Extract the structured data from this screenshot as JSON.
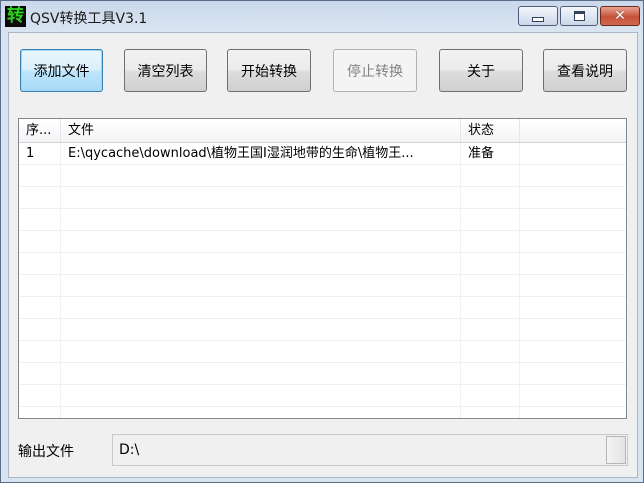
{
  "window": {
    "title": "QSV转换工具V3.1",
    "icon_char": "转"
  },
  "toolbar": {
    "add_file": "添加文件",
    "clear_list": "清空列表",
    "start_convert": "开始转换",
    "stop_convert": "停止转换",
    "about": "关于",
    "view_help": "查看说明"
  },
  "list": {
    "columns": {
      "seq": "序...",
      "file": "文件",
      "status": "状态"
    },
    "rows": [
      {
        "seq": "1",
        "file": "E:\\qycache\\download\\植物王国I湿润地带的生命\\植物王...",
        "status": "准备"
      }
    ]
  },
  "output": {
    "label": "输出文件",
    "value": "D:\\"
  },
  "icons": {
    "minimize": "minimize-icon",
    "maximize": "maximize-icon",
    "close": "close-icon"
  }
}
